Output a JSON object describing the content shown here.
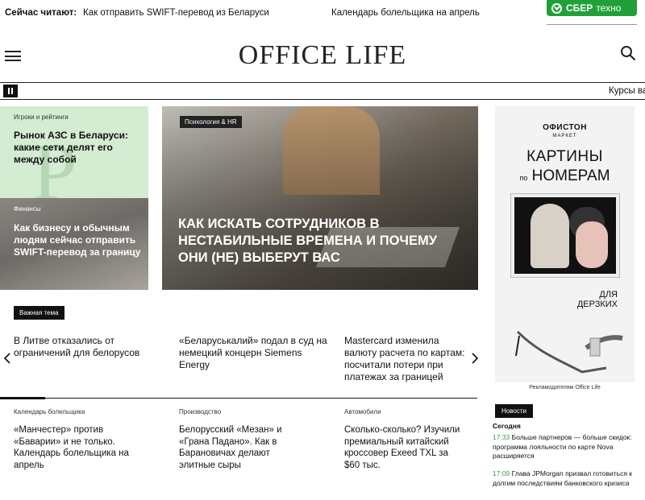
{
  "topbar": {
    "label": "Сейчас читают:",
    "links": [
      "Как отправить SWIFT-перевод из Беларуси",
      "Календарь болельщика на апрель"
    ],
    "sber_brand": "СБЕР",
    "sber_sub": "техно",
    "sber_color": "#21a038"
  },
  "header": {
    "logo": "OFFICE LIFE",
    "menu_icon": "hamburger-icon",
    "search_icon": "search-icon"
  },
  "ticker": {
    "text": "Курсы ва"
  },
  "left_cards": [
    {
      "category": "Игроки и рейтинги",
      "title": "Рынок АЗС в Беларуси: какие сети делят его между собой",
      "bg": "#d3ecd2"
    },
    {
      "category": "Финансы",
      "title": "Как бизнесу и обычным людям сейчас отправить SWIFT-перевод за границу"
    }
  ],
  "hero": {
    "tag": "Психология & HR",
    "title": "Как искать сотрудников в нестабильные времена и почему они (не) выберут вас"
  },
  "ad": {
    "brand": "ОФИСТОН",
    "brand_sub": "МАРКЕТ",
    "headline1": "КАРТИНЫ",
    "headline2_prefix": "по",
    "headline2": "НОМЕРАМ",
    "tagline_1": "ДЛЯ",
    "tagline_2": "ДЕРЗКИХ",
    "caption": "Рекламодателям Office Life"
  },
  "important": {
    "tag": "Важная тема",
    "items": [
      "В Литве отказались от ограничений для белорусов",
      "«Беларуськалий» подал в суд на немецкий концерн Siemens Energy",
      "Mastercard изменила валюту расчета по картам: посчитали потери при платежах за границей"
    ]
  },
  "bottom": [
    {
      "category": "Календарь болельщика",
      "title": "«Манчестер» против «Баварии» и не только. Календарь болельщика на апрель"
    },
    {
      "category": "Производство",
      "title": "Белорусский «Мезан» и «Грана Падано». Как в Барановичах делают элитные сыры"
    },
    {
      "category": "Автомобили",
      "title": "Сколько-сколько? Изучили премиальный китайский кроссовер Exeed TXL за $60 тыс."
    }
  ],
  "news": {
    "tag": "Новости",
    "day": "Сегодня",
    "items": [
      {
        "time": "17:33",
        "text": "Больше партнеров — больше скидок: программа лояльности по карте Nova расширяется"
      },
      {
        "time": "17:09",
        "text": "Глава JPMorgan призвал готовиться к долгим последствиям банковского кризиса"
      }
    ],
    "time_color": "#3a9c3a"
  }
}
